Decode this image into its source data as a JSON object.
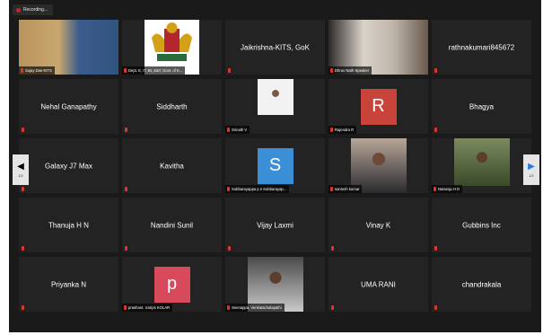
{
  "recording": {
    "label": "Recording..."
  },
  "pager": {
    "prev_text": "1/2",
    "next_text": "1/2"
  },
  "tiles": [
    {
      "type": "video",
      "label": "Sujay Das-KITS",
      "active": true
    },
    {
      "type": "logo",
      "label": "Dept. E, IT, Bt, S&T, Govt. of K..."
    },
    {
      "type": "name",
      "name": "Jaikrishna-KITS, GoK"
    },
    {
      "type": "video",
      "label": "Dhruv Nath-Speaker"
    },
    {
      "type": "name",
      "name": "rathnakumari845672"
    },
    {
      "type": "name",
      "name": "Nehal Ganapathy"
    },
    {
      "type": "name",
      "name": "Siddharth"
    },
    {
      "type": "photo",
      "label": "Srinath V"
    },
    {
      "type": "avatar",
      "letter": "R",
      "color": "#c8443a",
      "label": "Rajendra R"
    },
    {
      "type": "name",
      "name": "Bhagya"
    },
    {
      "type": "name",
      "name": "Galaxy J7 Max"
    },
    {
      "type": "name",
      "name": "Kavitha"
    },
    {
      "type": "avatar",
      "letter": "S",
      "color": "#3b8fd6",
      "label": "Subbarayappa p s Subbarayap..."
    },
    {
      "type": "photo",
      "label": "santosh kumar"
    },
    {
      "type": "photo",
      "label": "Nataraju H D"
    },
    {
      "type": "name",
      "name": "Thanuja H N"
    },
    {
      "type": "name",
      "name": "Nandini Sunil"
    },
    {
      "type": "name",
      "name": "Vijay Laxmi"
    },
    {
      "type": "name",
      "name": "Vinay K"
    },
    {
      "type": "name",
      "name": "Gubbins Inc"
    },
    {
      "type": "name",
      "name": "Priyanka N"
    },
    {
      "type": "avatar",
      "letter": "p",
      "color": "#d64a5c",
      "label": "prashant. Icsrips KOLAR"
    },
    {
      "type": "photo",
      "label": "Seenappa, Venkatachalapathi"
    },
    {
      "type": "name",
      "name": "UMA RANI"
    },
    {
      "type": "name",
      "name": "chandrakala"
    }
  ]
}
